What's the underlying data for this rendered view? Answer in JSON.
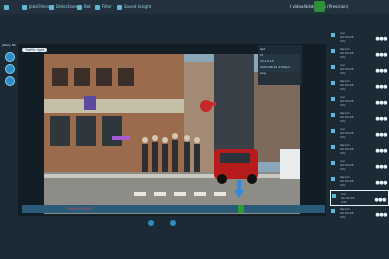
{
  "topbar": {
    "tabs": [
      "JobsFilters",
      "Detections",
      "Bot",
      "Filter",
      "Saved Insight"
    ],
    "right_title": "I video4k4demo.p (Prevision)"
  },
  "left_label": "Jittery ML",
  "stage_tag": "Traffic light",
  "panel": {
    "lines": [
      "Set",
      "Id",
      "12-10.13",
      "2023-09-21 1:05pm",
      "Aug"
    ]
  },
  "timeline": {
    "time": "00:00:00:000"
  },
  "sidebar": {
    "rows": [
      {
        "name": "Car",
        "time": "00:00:05",
        "date": "00:00:01:00",
        "meta": "Info"
      },
      {
        "name": "Person",
        "time": "00:00:05",
        "date": "00:00:01:00",
        "meta": "Info"
      },
      {
        "name": "Car",
        "time": "00:00:05",
        "date": "00:00:01:00",
        "meta": "Info"
      },
      {
        "name": "Person",
        "time": "00:00:05",
        "date": "00:00:01:00",
        "meta": "Info"
      },
      {
        "name": "Car",
        "time": "00:00:05",
        "date": "00:00:01:00",
        "meta": "Info"
      },
      {
        "name": "Person",
        "time": "00:00:05",
        "date": "00:00:01:00",
        "meta": "Info"
      },
      {
        "name": "Car",
        "time": "00:00:05",
        "date": "00:00:01:00",
        "meta": "Info"
      },
      {
        "name": "Person",
        "time": "00:00:05",
        "date": "00:00:01:00",
        "meta": "Info"
      },
      {
        "name": "Car",
        "time": "00:00:05",
        "date": "00:00:01:00",
        "meta": "Info"
      },
      {
        "name": "Person",
        "time": "00:00:05",
        "date": "00:00:01:00",
        "meta": "Info"
      },
      {
        "name": "Car",
        "time": "00:00:05",
        "date": "00:00:01:00",
        "meta": "Info"
      },
      {
        "name": "Person",
        "time": "00:00:05",
        "date": "00:00:01:00",
        "meta": "Info"
      }
    ]
  }
}
